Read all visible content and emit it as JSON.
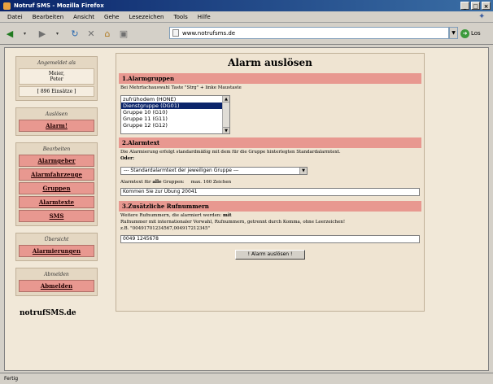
{
  "window": {
    "title": "Notruf SMS - Mozilla Firefox"
  },
  "menu": [
    "Datei",
    "Bearbeiten",
    "Ansicht",
    "Gehe",
    "Lesezeichen",
    "Tools",
    "Hilfe"
  ],
  "address": {
    "url": "www.notrufsms.de",
    "go_label": "Los"
  },
  "sidebar": {
    "login_head": "Angemeldet als",
    "user_name": "Meier,",
    "user_first": "Peter",
    "sms_credit": "[ 896 Einsätze ]",
    "trigger_head": "Auslösen",
    "trigger_link": "Alarm!",
    "edit_head": "Bearbeiten",
    "edit_links": [
      "Alarmgeber",
      "Alarmfahrzeuge",
      "Gruppen",
      "Alarmtexte",
      "SMS"
    ],
    "overview_head": "Übersicht",
    "overview_link": "Alarmierungen",
    "logout_head": "Abmelden",
    "logout_link": "Abmelden",
    "brand": "notrufSMS.de"
  },
  "main": {
    "title": "Alarm auslösen",
    "section1": {
      "heading": "1.Alarmgruppen",
      "hint": "Bei Mehrfachauswahl Taste \"Strg\" + linke Maustaste",
      "list": [
        {
          "label": "zufrühodem (HONE)",
          "selected": false
        },
        {
          "label": "Dienstgruppe (DG01)",
          "selected": true
        },
        {
          "label": "Gruppe 10 (G10)",
          "selected": false
        },
        {
          "label": "Gruppe 11 (G11)",
          "selected": false
        },
        {
          "label": "Gruppe 12 (G12)",
          "selected": false
        }
      ]
    },
    "section2": {
      "heading": "2.Alarmtext",
      "text": "Die Alarmierung erfolgt standardmäßig mit dem für die Gruppe hinterlegten Standardalarmtext.",
      "text_bold": "Oder:",
      "select_value": "--- Standardalarmtext der jeweiligen Gruppe ---",
      "custom_label_prefix": "Alarmtext für",
      "custom_label_bold": "alle",
      "custom_label_suffix": "Gruppen:",
      "custom_hint": "max. 160 Zeichen",
      "custom_value": "Kommen Sie zur Übung 20041"
    },
    "section3": {
      "heading": "3.Zusätzliche Rufnummern",
      "line1": "Weitere Rufnummern, die alarmiert werden:",
      "line1_bold": "mit",
      "line2": "Rufnummern, getrennt durch Komma, ohne Leerzeichen!",
      "line2_prefix": "Rufnummer mit internationaler Vorwahl",
      "line3": "z.B. \"00491701234567,004917212345\"",
      "phone_value": "0049 1245678"
    },
    "submit_label": "! Alarm auslösen !"
  },
  "status": {
    "text": "Fertig"
  }
}
